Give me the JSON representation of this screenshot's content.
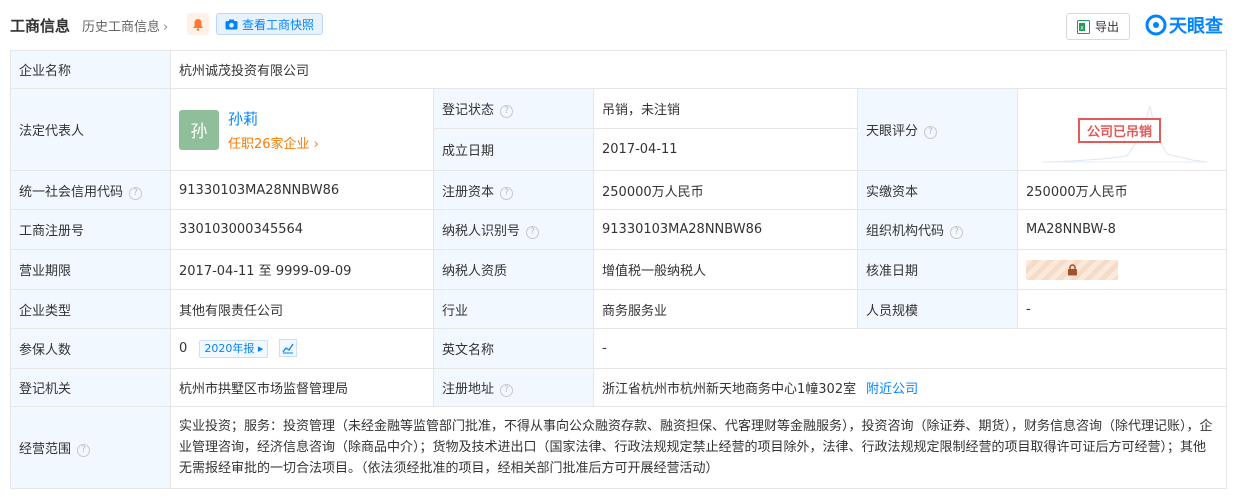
{
  "header": {
    "title": "工商信息",
    "history_link": "历史工商信息",
    "snapshot_button": "查看工商快照",
    "export_button": "导出",
    "logo_text": "天眼查"
  },
  "rows": {
    "company_name": {
      "label": "企业名称",
      "value": "杭州诚茂投资有限公司"
    },
    "legal_rep": {
      "label": "法定代表人",
      "avatar_char": "孙",
      "name": "孙莉",
      "jobs": "任职26家企业"
    },
    "reg_status": {
      "label": "登记状态",
      "value": "吊销，未注销"
    },
    "found_date": {
      "label": "成立日期",
      "value": "2017-04-11"
    },
    "tianyan_score": {
      "label": "天眼评分",
      "stamp": "公司已吊销"
    },
    "credit_code": {
      "label": "统一社会信用代码",
      "value": "91330103MA28NNBW86"
    },
    "reg_capital": {
      "label": "注册资本",
      "value": "250000万人民币"
    },
    "paid_capital": {
      "label": "实缴资本",
      "value": "250000万人民币"
    },
    "reg_number": {
      "label": "工商注册号",
      "value": "330103000345564"
    },
    "taxpayer_id": {
      "label": "纳税人识别号",
      "value": "91330103MA28NNBW86"
    },
    "org_code": {
      "label": "组织机构代码",
      "value": "MA28NNBW-8"
    },
    "business_term": {
      "label": "营业期限",
      "value": "2017-04-11 至 9999-09-09"
    },
    "taxpayer_qual": {
      "label": "纳税人资质",
      "value": "增值税一般纳税人"
    },
    "approval_date": {
      "label": "核准日期"
    },
    "company_type": {
      "label": "企业类型",
      "value": "其他有限责任公司"
    },
    "industry": {
      "label": "行业",
      "value": "商务服务业"
    },
    "staff_size": {
      "label": "人员规模",
      "value": "-"
    },
    "insured": {
      "label": "参保人数",
      "value": "0",
      "year_tag": "2020年报"
    },
    "english_name": {
      "label": "英文名称",
      "value": "-"
    },
    "reg_authority": {
      "label": "登记机关",
      "value": "杭州市拱墅区市场监督管理局"
    },
    "reg_address": {
      "label": "注册地址",
      "value": "浙江省杭州市杭州新天地商务中心1幢302室",
      "nearby": "附近公司"
    },
    "scope": {
      "label": "经营范围",
      "value": "实业投资；服务：投资管理（未经金融等监管部门批准，不得从事向公众融资存款、融资担保、代客理财等金融服务），投资咨询（除证券、期货），财务信息咨询（除代理记账），企业管理咨询，经济信息咨询（除商品中介）；货物及技术进出口（国家法律、行政法规规定禁止经营的项目除外，法律、行政法规规定限制经营的项目取得许可证后方可经营）；其他无需报经审批的一切合法项目。（依法须经批准的项目，经相关部门批准后方可开展经营活动）"
    }
  }
}
